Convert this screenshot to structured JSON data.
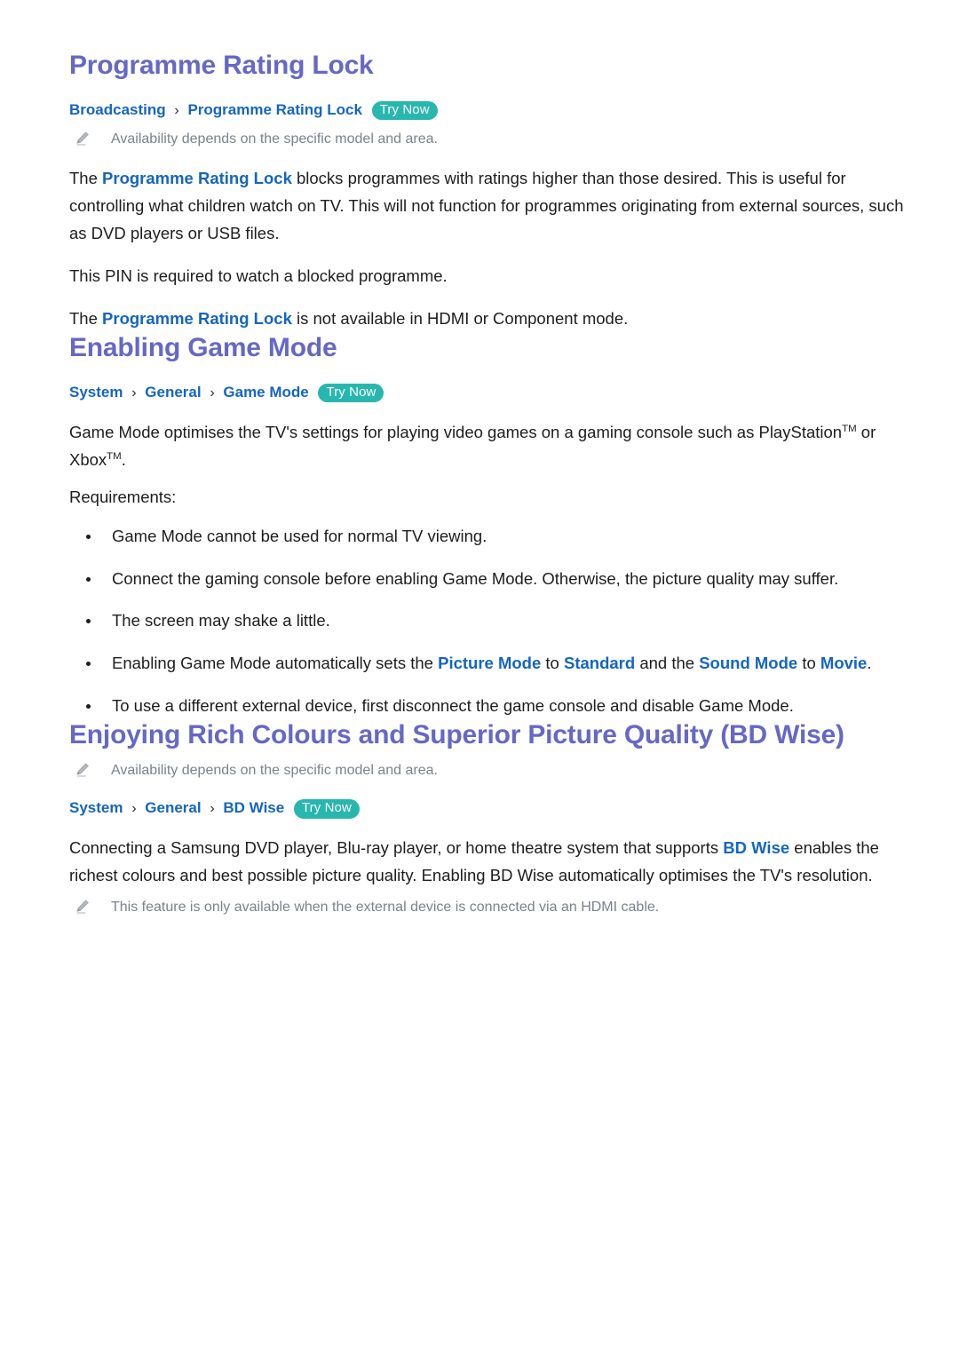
{
  "sections": [
    {
      "id": "programme-rating-lock",
      "title": "Programme Rating Lock",
      "breadcrumb": {
        "crumbs": [
          "Broadcasting",
          "Programme Rating Lock"
        ],
        "separator": "›",
        "try_now_label": "Try Now"
      },
      "note_top": "Availability depends on the specific model and area.",
      "paragraphs": [
        {
          "parts": [
            {
              "text": "The ",
              "link": false
            },
            {
              "text": "Programme Rating Lock",
              "link": true
            },
            {
              "text": " blocks programmes with ratings higher than those desired. This is useful for controlling what children watch on TV. This will not function for programmes originating from external sources, such as DVD players or USB files.",
              "link": false
            }
          ]
        },
        {
          "parts": [
            {
              "text": "This PIN is required to watch a blocked programme.",
              "link": false
            }
          ]
        },
        {
          "parts": [
            {
              "text": "The ",
              "link": false
            },
            {
              "text": "Programme Rating Lock",
              "link": true
            },
            {
              "text": " is not available in HDMI or Component mode.",
              "link": false
            }
          ]
        }
      ]
    },
    {
      "id": "enabling-game-mode",
      "title": "Enabling Game Mode",
      "breadcrumb": {
        "crumbs": [
          "System",
          "General",
          "Game Mode"
        ],
        "separator": "›",
        "try_now_label": "Try Now"
      },
      "paragraphs": [
        {
          "parts": [
            {
              "text": "Game Mode optimises the TV's settings for playing video games on a gaming console such as PlayStation",
              "link": false
            },
            {
              "text": "TM",
              "sup": true
            },
            {
              "text": " or Xbox",
              "link": false
            },
            {
              "text": "TM",
              "sup": true
            },
            {
              "text": ".",
              "link": false
            }
          ]
        },
        {
          "parts": [
            {
              "text": "Requirements:",
              "link": false
            }
          ]
        }
      ],
      "bullets": [
        {
          "parts": [
            {
              "text": "Game Mode cannot be used for normal TV viewing.",
              "link": false
            }
          ]
        },
        {
          "parts": [
            {
              "text": "Connect the gaming console before enabling Game Mode. Otherwise, the picture quality may suffer.",
              "link": false
            }
          ]
        },
        {
          "parts": [
            {
              "text": "The screen may shake a little.",
              "link": false
            }
          ]
        },
        {
          "parts": [
            {
              "text": "Enabling Game Mode automatically sets the ",
              "link": false
            },
            {
              "text": "Picture Mode",
              "link": true
            },
            {
              "text": " to ",
              "link": false
            },
            {
              "text": "Standard",
              "link": true
            },
            {
              "text": " and the ",
              "link": false
            },
            {
              "text": "Sound Mode",
              "link": true
            },
            {
              "text": " to ",
              "link": false
            },
            {
              "text": "Movie",
              "link": true
            },
            {
              "text": ".",
              "link": false
            }
          ]
        },
        {
          "parts": [
            {
              "text": "To use a different external device, first disconnect the game console and disable Game Mode.",
              "link": false
            }
          ]
        }
      ]
    },
    {
      "id": "bd-wise",
      "title": "Enjoying Rich Colours and Superior Picture Quality (BD Wise)",
      "note_top": "Availability depends on the specific model and area.",
      "breadcrumb": {
        "crumbs": [
          "System",
          "General",
          "BD Wise"
        ],
        "separator": "›",
        "try_now_label": "Try Now"
      },
      "paragraphs": [
        {
          "parts": [
            {
              "text": "Connecting a Samsung DVD player, Blu-ray player, or home theatre system that supports ",
              "link": false
            },
            {
              "text": "BD Wise",
              "link": true
            },
            {
              "text": " enables the richest colours and best possible picture quality. Enabling BD Wise automatically optimises the TV's resolution.",
              "link": false
            }
          ]
        }
      ],
      "note_bottom": "This feature is only available when the external device is connected via an HDMI cable."
    }
  ],
  "icons": {
    "note_icon_name": "pencil-icon"
  },
  "colors": {
    "heading": "#6568c4",
    "link": "#1565c0",
    "badge_bg": "#28b7ae",
    "badge_text": "#ffffff",
    "note_text": "#7a828d",
    "body_text": "#1d1d1d",
    "page_bg": "#ffffff"
  }
}
